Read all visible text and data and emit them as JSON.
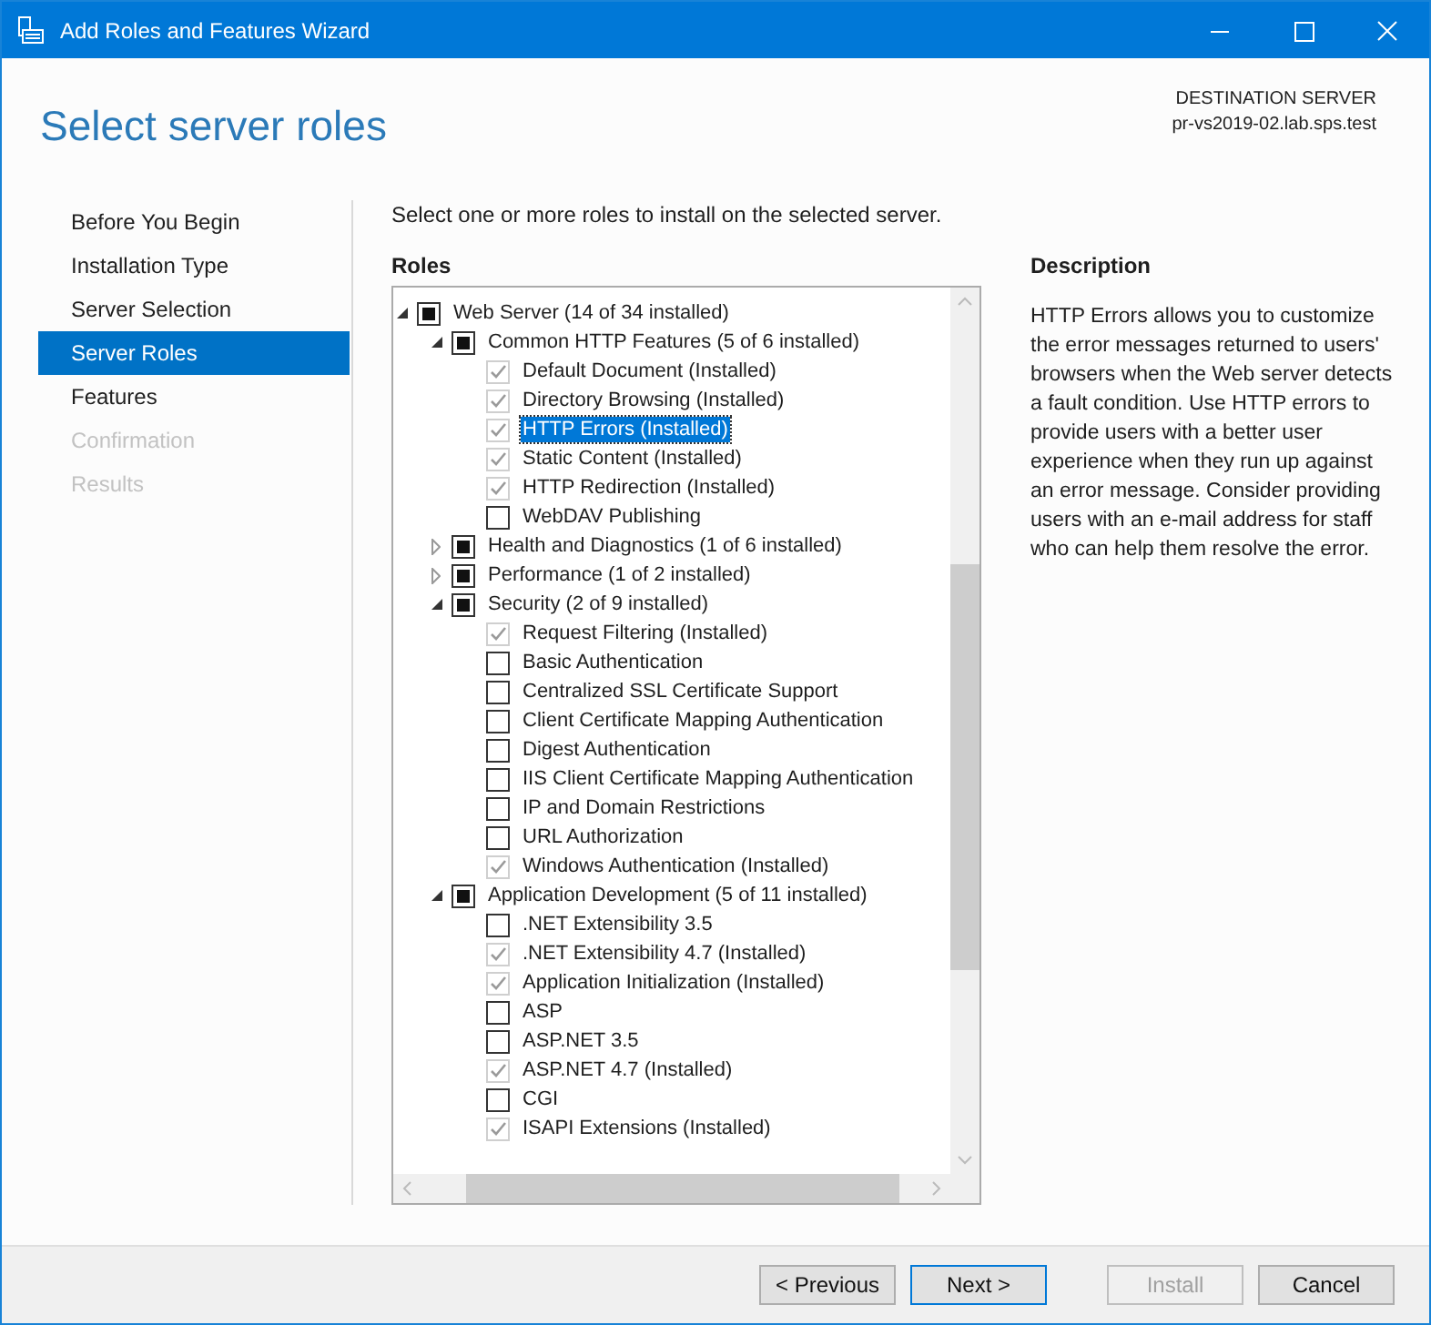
{
  "window": {
    "title": "Add Roles and Features Wizard"
  },
  "header": {
    "title": "Select server roles",
    "destination_label": "DESTINATION SERVER",
    "destination_server": "pr-vs2019-02.lab.sps.test"
  },
  "sidebar": {
    "items": [
      {
        "label": "Before You Begin",
        "selected": false,
        "disabled": false
      },
      {
        "label": "Installation Type",
        "selected": false,
        "disabled": false
      },
      {
        "label": "Server Selection",
        "selected": false,
        "disabled": false
      },
      {
        "label": "Server Roles",
        "selected": true,
        "disabled": false
      },
      {
        "label": "Features",
        "selected": false,
        "disabled": false
      },
      {
        "label": "Confirmation",
        "selected": false,
        "disabled": true
      },
      {
        "label": "Results",
        "selected": false,
        "disabled": true
      }
    ]
  },
  "instruction": "Select one or more roles to install on the selected server.",
  "roles": {
    "heading": "Roles",
    "tree": [
      {
        "label": "Web Server (14 of 34 installed)",
        "kind": "partial",
        "expanded": true,
        "selected": false,
        "children": [
          {
            "label": "Common HTTP Features (5 of 6 installed)",
            "kind": "partial",
            "expanded": true,
            "selected": false,
            "children": [
              {
                "label": "Default Document (Installed)",
                "kind": "installed",
                "selected": false
              },
              {
                "label": "Directory Browsing (Installed)",
                "kind": "installed",
                "selected": false
              },
              {
                "label": "HTTP Errors (Installed)",
                "kind": "installed",
                "selected": true
              },
              {
                "label": "Static Content (Installed)",
                "kind": "installed",
                "selected": false
              },
              {
                "label": "HTTP Redirection (Installed)",
                "kind": "installed",
                "selected": false
              },
              {
                "label": "WebDAV Publishing",
                "kind": "unchecked",
                "selected": false
              }
            ]
          },
          {
            "label": "Health and Diagnostics (1 of 6 installed)",
            "kind": "partial",
            "expanded": false,
            "selected": false
          },
          {
            "label": "Performance (1 of 2 installed)",
            "kind": "partial",
            "expanded": false,
            "selected": false
          },
          {
            "label": "Security (2 of 9 installed)",
            "kind": "partial",
            "expanded": true,
            "selected": false,
            "children": [
              {
                "label": "Request Filtering (Installed)",
                "kind": "installed",
                "selected": false
              },
              {
                "label": "Basic Authentication",
                "kind": "unchecked",
                "selected": false
              },
              {
                "label": "Centralized SSL Certificate Support",
                "kind": "unchecked",
                "selected": false
              },
              {
                "label": "Client Certificate Mapping Authentication",
                "kind": "unchecked",
                "selected": false
              },
              {
                "label": "Digest Authentication",
                "kind": "unchecked",
                "selected": false
              },
              {
                "label": "IIS Client Certificate Mapping Authentication",
                "kind": "unchecked",
                "selected": false
              },
              {
                "label": "IP and Domain Restrictions",
                "kind": "unchecked",
                "selected": false
              },
              {
                "label": "URL Authorization",
                "kind": "unchecked",
                "selected": false
              },
              {
                "label": "Windows Authentication (Installed)",
                "kind": "installed",
                "selected": false
              }
            ]
          },
          {
            "label": "Application Development (5 of 11 installed)",
            "kind": "partial",
            "expanded": true,
            "selected": false,
            "children": [
              {
                "label": ".NET Extensibility 3.5",
                "kind": "unchecked",
                "selected": false
              },
              {
                "label": ".NET Extensibility 4.7 (Installed)",
                "kind": "installed",
                "selected": false
              },
              {
                "label": "Application Initialization (Installed)",
                "kind": "installed",
                "selected": false
              },
              {
                "label": "ASP",
                "kind": "unchecked",
                "selected": false
              },
              {
                "label": "ASP.NET 3.5",
                "kind": "unchecked",
                "selected": false
              },
              {
                "label": "ASP.NET 4.7 (Installed)",
                "kind": "installed",
                "selected": false
              },
              {
                "label": "CGI",
                "kind": "unchecked",
                "selected": false
              },
              {
                "label": "ISAPI Extensions (Installed)",
                "kind": "installed",
                "selected": false
              }
            ]
          }
        ]
      }
    ]
  },
  "description": {
    "heading": "Description",
    "text": "HTTP Errors allows you to customize the error messages returned to users' browsers when the Web server detects a fault condition. Use HTTP errors to provide users with a better user experience when they run up against an error message. Consider providing users with an e-mail address for staff who can help them resolve the error."
  },
  "buttons": [
    {
      "label": "< Previous",
      "default": false,
      "disabled": false
    },
    {
      "label": "Next >",
      "default": true,
      "disabled": false
    },
    {
      "label": "Install",
      "default": false,
      "disabled": true
    },
    {
      "label": "Cancel",
      "default": false,
      "disabled": false
    }
  ]
}
